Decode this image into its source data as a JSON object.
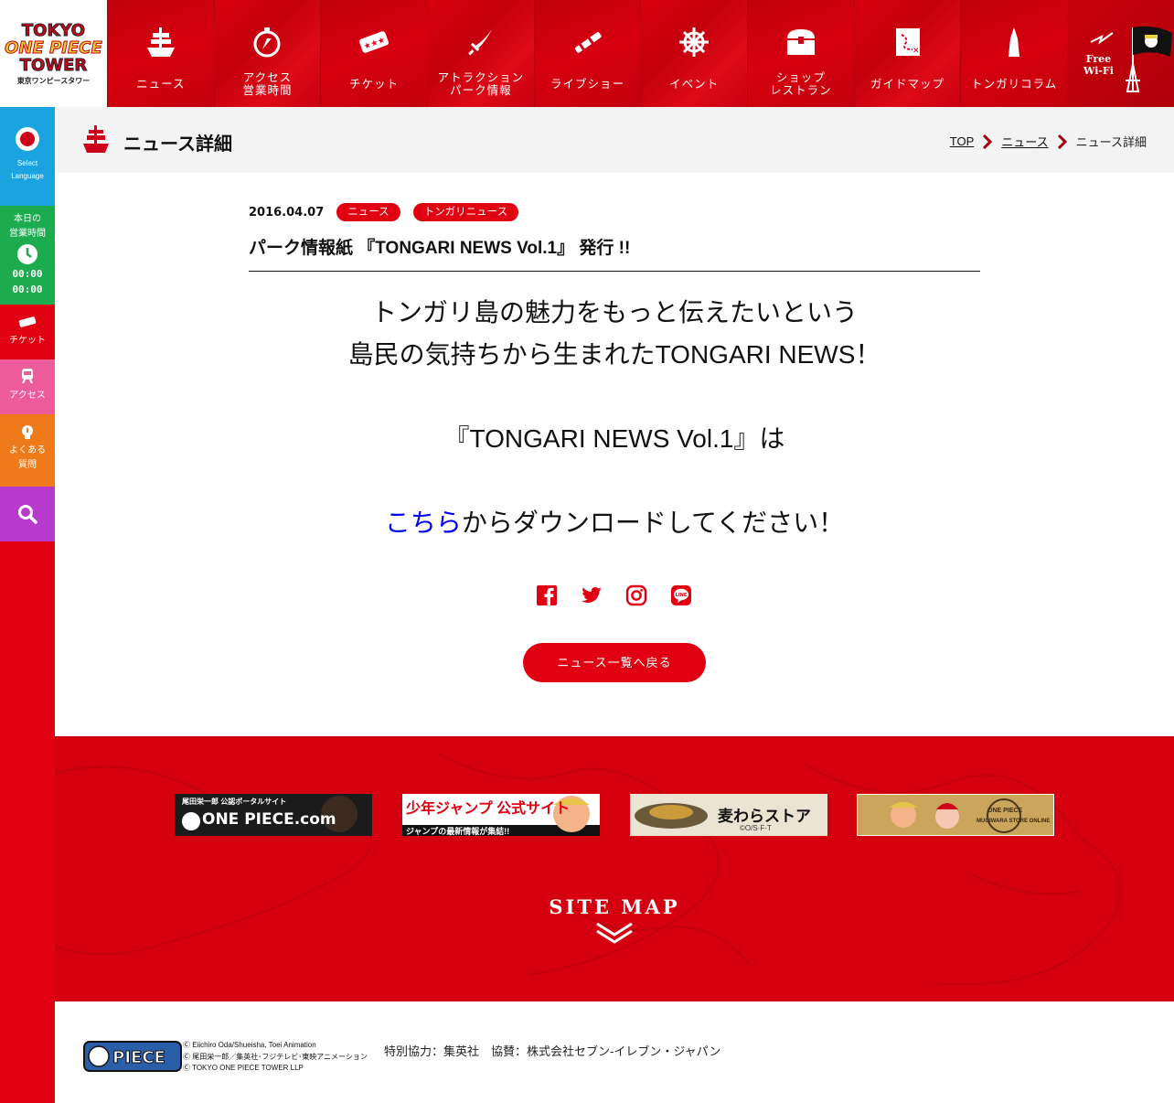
{
  "logo": {
    "line1": "TOKYO",
    "line2": "ONE PIECE",
    "line3": "TOWER",
    "line4": "東京ワンピースタワー"
  },
  "nav": [
    {
      "label": "ニュース",
      "icon": "ship-icon"
    },
    {
      "label": "アクセス\n営業時間",
      "icon": "compass-icon"
    },
    {
      "label": "チケット",
      "icon": "ticket-icon"
    },
    {
      "label": "アトラクション\nパーク情報",
      "icon": "sword-icon"
    },
    {
      "label": "ライブショー",
      "icon": "telescope-icon"
    },
    {
      "label": "イベント",
      "icon": "helm-icon"
    },
    {
      "label": "ショップ\nレストラン",
      "icon": "treasure-chest-icon"
    },
    {
      "label": "ガイドマップ",
      "icon": "map-icon"
    },
    {
      "label": "トンガリコラム",
      "icon": "tower-icon"
    }
  ],
  "wifi": {
    "label": "Free\nWi-Fi"
  },
  "sidebar": {
    "lang": {
      "line1": "Select",
      "line2": "Language"
    },
    "hours": {
      "line1": "本日の",
      "line2": "営業時間",
      "open": "00:00",
      "close": "00:00"
    },
    "ticket": "チケット",
    "access": "アクセス",
    "faq": {
      "line1": "よくある",
      "line2": "質問"
    }
  },
  "page": {
    "title": "ニュース詳細"
  },
  "breadcrumb": {
    "top": "TOP",
    "news": "ニュース",
    "current": "ニュース詳細"
  },
  "article": {
    "date": "2016.04.07",
    "tags": [
      "ニュース",
      "トンガリニュース"
    ],
    "title": "パーク情報紙 『TONGARI NEWS Vol.1』 発行 !!",
    "line1": "トンガリ島の魅力をもっと伝えたいという",
    "line2": "島民の気持ちから生まれたTONGARI NEWS！",
    "line3": "『TONGARI NEWS Vol.1』は",
    "link": "こちら",
    "line4": "からダウンロードしてください！"
  },
  "back_button": "ニュース一覧へ戻る",
  "banners": [
    {
      "title": "尾田栄一郎 公認ポータルサイト",
      "sub": "ONE PIECE.com"
    },
    {
      "title": "少年ジャンプ 公式サイト",
      "sub": "ジャンプの最新情報が集結!!"
    },
    {
      "title": "麦わらストア",
      "sub": "©O/S·F·T"
    },
    {
      "title": "ONE PIECE",
      "sub": "MUGIWARA STORE ONLINE"
    }
  ],
  "sitemap": "SITE MAP",
  "footer": {
    "copy1": "Ⓒ Eiichiro Oda/Shueisha, Toei Animation",
    "copy2": "Ⓒ 尾田栄一郎／集英社･フジテレビ･東映アニメーション",
    "copy3": "Ⓒ TOKYO ONE PIECE TOWER LLP",
    "sponsor": "特別協力：集英社　協賛：株式会社セブン-イレブン・ジャパン"
  },
  "colors": {
    "brand_red": "#e00012",
    "lang_blue": "#1aa3de",
    "hours_green": "#1cab4e",
    "access_pink": "#ec5c9b",
    "faq_orange": "#ef7a1a",
    "search_purple": "#b63bcc"
  }
}
